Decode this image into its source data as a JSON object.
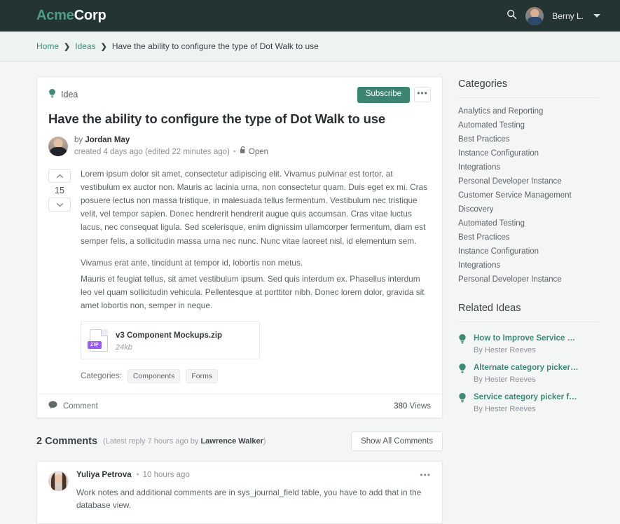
{
  "topnav": {
    "brand_first": "Acme",
    "brand_second": "Corp",
    "search_icon": "search-icon",
    "username": "Berny L.",
    "caret_icon": "chevron-down-icon"
  },
  "breadcrumb": {
    "items": [
      {
        "label": "Home",
        "type": "link"
      },
      {
        "label": "Ideas",
        "type": "link"
      },
      {
        "label": "Have the ability to configure the type of Dot Walk to use",
        "type": "current"
      }
    ],
    "separator": "›"
  },
  "idea": {
    "kind_label": "Idea",
    "kind_icon": "lightbulb-icon",
    "subscribe_label": "Subscribe",
    "more_label": "•••",
    "title": "Have the ability to configure the type of Dot Walk to use",
    "author_prefix": "by ",
    "author_name": "Jordan May",
    "created_text": "created 4 days ago (edited 22 minutes ago)",
    "separator_dot": "•",
    "status_label": "Open",
    "status_icon": "unlock-icon",
    "vote_count": "15",
    "vote_up_icon": "chevron-up-icon",
    "vote_down_icon": "chevron-down-icon",
    "paragraphs": [
      "Lorem ipsum dolor sit amet, consectetur adipiscing elit. Vivamus pulvinar est tortor, at vestibulum ex auctor non. Mauris ac lacinia urna, non consectetur quam. Duis eget ex mi. Cras posuere lectus non massa tristique, in malesuada tellus fermentum. Vestibulum nec tristique velit, vel tempor sapien. Donec hendrerit hendrerit augue quis accumsan. Cras vitae luctus lacus, nec consequat ligula. Sed scelerisque, enim dignissim ullamcorper fermentum, diam est semper felis, a sollicitudin massa urna nec nunc. Nunc vitae laoreet nisl, id elementum sem.",
      "Vivamus erat ante, tincidunt at tempor id, lobortis non metus.",
      "Mauris et feugiat tellus, sit amet vestibulum ipsum. Sed quis interdum ex. Phasellus interdum leo vel quam sollicitudin vehicula. Pellentesque at porttitor nibh. Donec lorem dolor, gravida sit amet lobortis non, semper in neque."
    ],
    "attachment": {
      "icon": "zip-file-icon",
      "badge": "ZIP",
      "name": "v3 Component Mockups.zip",
      "size": "24kb"
    },
    "categories_label": "Categories:",
    "category_tags": [
      "Components",
      "Forms"
    ],
    "comment_action_label": "Comment",
    "comment_icon": "comment-bubble-icon",
    "views_count": "380",
    "views_label": "Views"
  },
  "comments": {
    "heading": "2 Comments",
    "meta_prefix": "(Latest reply 7 hours ago by ",
    "meta_author": "Lawrence Walker",
    "meta_suffix": ")",
    "show_all_label": "Show All Comments",
    "items": [
      {
        "author": "Yuliya Petrova",
        "separator": "•",
        "time": "10 hours ago",
        "menu": "•••",
        "text": "Work notes and additional comments are in sys_journal_field table, you have to add that in the database view."
      }
    ]
  },
  "sidebar": {
    "categories_title": "Categories",
    "categories": [
      "Analytics and Reporting",
      "Automated Testing",
      "Best Practices",
      "Instance Configuration",
      "Integrations",
      "Personal Developer Instance",
      "Customer Service Management",
      "Discovery",
      "Automated Testing",
      "Best Practices",
      "Instance Configuration",
      "Integrations",
      "Personal Developer Instance"
    ],
    "related_title": "Related Ideas",
    "related": [
      {
        "title": "How to Improve Service Delivery",
        "author": "By Hester Reeves",
        "icon": "lightbulb-icon"
      },
      {
        "title": "Alternate category picker for…",
        "author": "By Hester Reeves",
        "icon": "lightbulb-icon"
      },
      {
        "title": "Service category picker for d…",
        "author": "By Hester Reeves",
        "icon": "lightbulb-icon"
      }
    ]
  },
  "colors": {
    "nav_bg": "#243433",
    "brand_accent": "#4e9b87",
    "link_teal": "#3f8a74",
    "subscribe_bg": "#3e8473",
    "zip_badge": "#9b5cf0",
    "page_bg": "#f4f6f6"
  }
}
